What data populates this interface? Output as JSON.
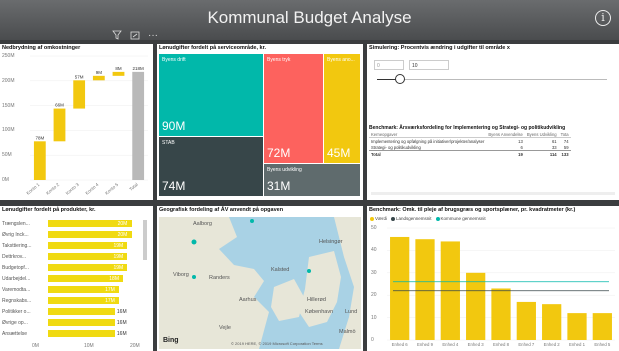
{
  "header": {
    "title": "Kommunal Budget Analyse",
    "info_glyph": "i"
  },
  "toolbar": {
    "filter_icon": "filter-icon",
    "focus_icon": "focus-icon",
    "more": "···"
  },
  "waterfall": {
    "title": "Nedbrydning af omkostninger",
    "ylabels": [
      "250M",
      "200M",
      "150M",
      "100M",
      "50M",
      "0M"
    ],
    "chart_data": {
      "type": "bar",
      "categories": [
        "Konto 1",
        "Konto 2",
        "Konto 3",
        "Konto 4",
        "Konto 5",
        "Total"
      ],
      "values": [
        78,
        66,
        57,
        9,
        8,
        218
      ],
      "labels": [
        "78M",
        "66M",
        "57M",
        "9M",
        "8M",
        "218M"
      ],
      "ylim": [
        0,
        250
      ]
    }
  },
  "treemap": {
    "title": "Lønudgifter fordelt på serviceområde, kr.",
    "cells": [
      {
        "label": "Byens drift",
        "value": "90M",
        "color": "#01b8aa"
      },
      {
        "label": "Byens tryk",
        "value": "72M",
        "color": "#fd625e"
      },
      {
        "label": "Byens ano...",
        "value": "45M",
        "color": "#f2c80f"
      },
      {
        "label": "STAB",
        "value": "74M",
        "color": "#374649"
      },
      {
        "label": "Byens udvikling",
        "value": "31M",
        "color": "#5f6b6d"
      }
    ]
  },
  "simulation": {
    "title": "Simulering: Procentvis ændring i udgifter til område x",
    "min": "0",
    "value": "10",
    "slider_fraction": 0.1
  },
  "benchmark_table": {
    "title": "Benchmark: Årsværksfordeling for Implementering og Strategi- og politikudvikling",
    "headers": [
      "Kerneopgaver",
      "Byens Anvendelse",
      "Byens Udvikling",
      "Tota"
    ],
    "rows": [
      [
        "Implementering og opfølgning på initiativer/projekter/analyser",
        "13",
        "61",
        "74"
      ],
      [
        "Strategi- og politikudvikling",
        "6",
        "33",
        "59"
      ]
    ],
    "total": [
      "Total",
      "19",
      "114",
      "133"
    ]
  },
  "hbars": {
    "title": "Lønudgifter fordelt på produkter, kr.",
    "xlabels": [
      "0M",
      "10M",
      "20M"
    ],
    "chart_data": {
      "type": "bar",
      "categories": [
        "Trængslen...",
        "Øvrig Inck...",
        "Taksttiering...",
        "Dettrkrov...",
        "Budgetopf...",
        "Udarbejdel...",
        "Varemodta...",
        "Regnskabs...",
        "Politikker o...",
        "Øvrige op...",
        "Ansættelse"
      ],
      "values": [
        20,
        20,
        19,
        19,
        19,
        18,
        17,
        17,
        16,
        16,
        16
      ],
      "labels": [
        "20M",
        "20M",
        "19M",
        "19M",
        "19M",
        "18M",
        "17M",
        "17M",
        "16M",
        "16M",
        "16M"
      ],
      "xlim": [
        0,
        22
      ]
    }
  },
  "map": {
    "title": "Geografisk fordeling af ÅV anvendt på opgaven",
    "places": [
      "Aalborg",
      "Viborg",
      "Randers",
      "Aarhus",
      "Vejle",
      "Kalsted",
      "Helsingør",
      "Hillerød",
      "København",
      "Lund",
      "Malmö"
    ],
    "credit": "© 2019 HERE, © 2019 Microsoft Corporation Terms",
    "bing": "Bing"
  },
  "columns": {
    "title": "Benchmark: Omk. til pleje af brugsgræs og sportsplæner, pr. kvadratmeter (kr.)",
    "legend": [
      "Værdi",
      "Landsgennemsnit",
      "Kommune gennemsnit"
    ],
    "legend_colors": [
      "#f2c80f",
      "#374649",
      "#01b8aa"
    ],
    "ylabels": [
      "50",
      "40",
      "30",
      "20",
      "10",
      "0"
    ],
    "chart_data": {
      "type": "bar",
      "categories": [
        "Enhed 6",
        "Enhed 9",
        "Enhed 4",
        "Enhed 3",
        "Enhed 8",
        "Enhed 7",
        "Enhed 2",
        "Enhed 1",
        "Enhed 5"
      ],
      "values": [
        46,
        45,
        44,
        30,
        23,
        17,
        16,
        12,
        12
      ],
      "lines": {
        "Landsgennemsnit": 22,
        "Kommune gennemsnit": 26
      },
      "ylim": [
        0,
        50
      ]
    }
  }
}
